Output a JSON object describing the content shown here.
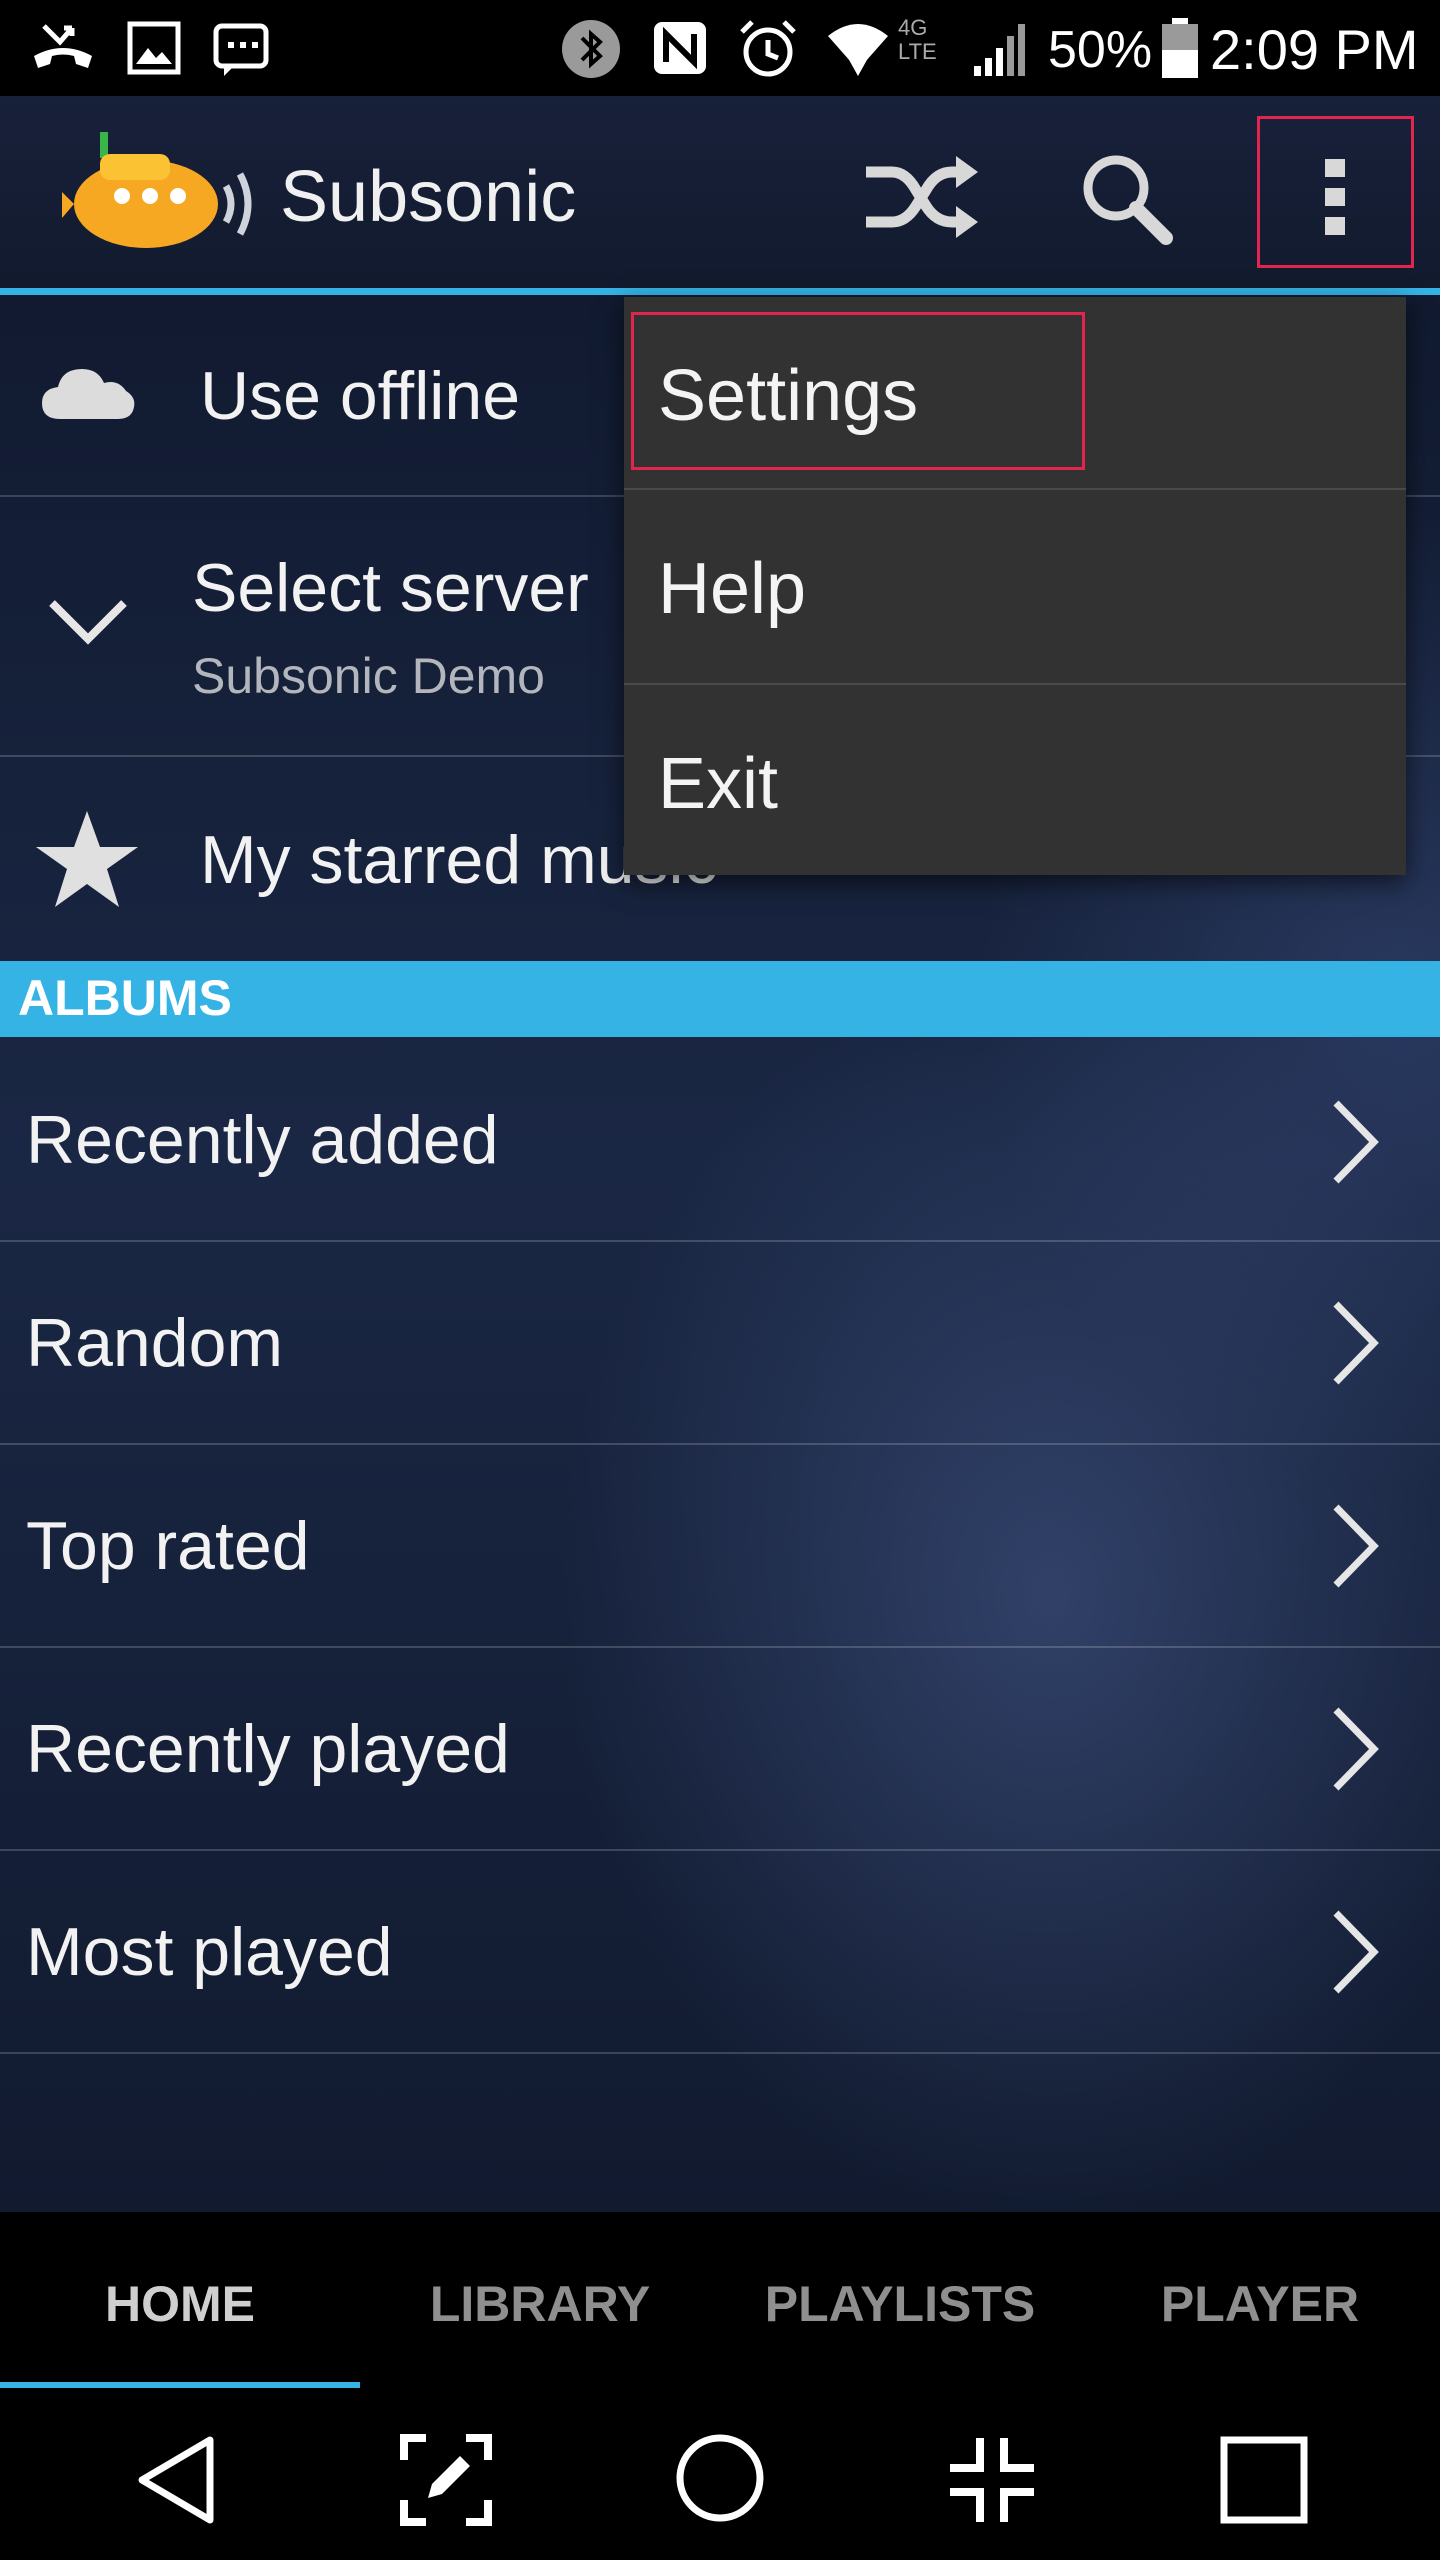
{
  "status_bar": {
    "battery": "50%",
    "time": "2:09 PM",
    "network_type": "4G LTE",
    "icons": [
      "missed-call-icon",
      "image-icon",
      "dialog-icon",
      "bluetooth-icon",
      "nfc-icon",
      "alarm-icon",
      "wifi-icon",
      "signal-icon",
      "battery-icon"
    ]
  },
  "app_bar": {
    "title": "Subsonic",
    "actions": [
      "shuffle-icon",
      "search-icon",
      "overflow-menu-icon"
    ]
  },
  "main": {
    "use_offline": "Use offline",
    "select_server": {
      "label": "Select server",
      "value": "Subsonic Demo"
    },
    "starred": "My starred music",
    "albums_header": "ALBUMS",
    "album_items": [
      "Recently added",
      "Random",
      "Top rated",
      "Recently played",
      "Most played"
    ]
  },
  "overflow_menu": {
    "items": [
      "Settings",
      "Help",
      "Exit"
    ]
  },
  "tabs": {
    "items": [
      "HOME",
      "LIBRARY",
      "PLAYLISTS",
      "PLAYER"
    ],
    "selected": "HOME"
  },
  "colors": {
    "accent": "#35b3e5",
    "highlight": "#e0264f",
    "menu_bg": "#323232"
  }
}
